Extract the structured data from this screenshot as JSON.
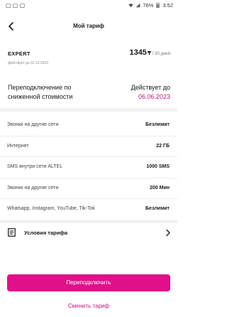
{
  "status_bar": {
    "time": "3:52",
    "battery": "76%"
  },
  "header": {
    "title": "Мой тариф"
  },
  "plan": {
    "name": "EXPERT",
    "valid_until": "Действует до 31.12.2023",
    "price": "1345",
    "currency": "₸",
    "period": "/ 30 дней"
  },
  "switch": {
    "label": "Переподключение по сниженной стоимости",
    "valid_label": "Действует до",
    "date": "06.06.2023"
  },
  "features": [
    {
      "label": "Звонки на другие сети",
      "value": "Безлимит"
    },
    {
      "label": "Интернет",
      "value": "22 ГБ"
    },
    {
      "label": "SMS внутри сети ALTEL",
      "value": "1000 SMS"
    },
    {
      "label": "Звонки на другие сети",
      "value": "200 Мин"
    },
    {
      "label": "Whatsapp, Instagram, YouTube, Tik-Tok",
      "value": "Безлимит"
    }
  ],
  "terms": {
    "label": "Условия тарифа"
  },
  "actions": {
    "primary": "Переподключить",
    "secondary": "Сменить тариф"
  },
  "colors": {
    "accent": "#e0108a",
    "accent_text": "#c2187e"
  },
  "icons": [
    "back-arrow-icon",
    "document-icon",
    "chevron-right-icon",
    "battery-icon",
    "signal-icon",
    "wifi-icon"
  ]
}
